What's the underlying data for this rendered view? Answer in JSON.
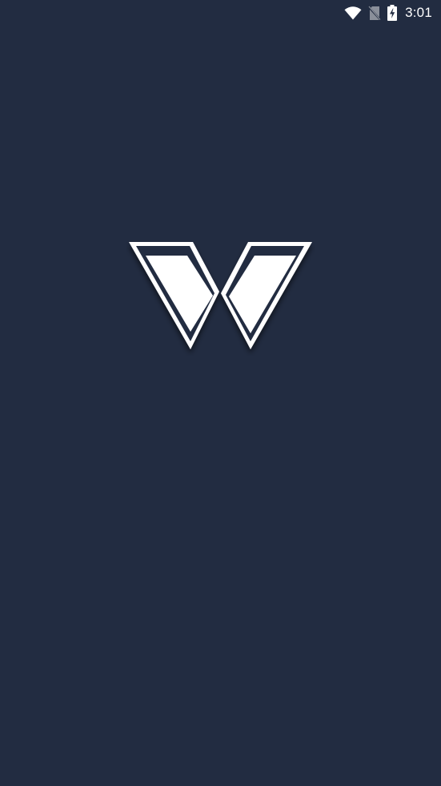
{
  "status_bar": {
    "time": "3:01",
    "icons": [
      "wifi-icon",
      "no-sim-icon",
      "battery-charging-icon"
    ],
    "icon_color": "#ffffff"
  },
  "splash": {
    "logo": "app-logo-w",
    "background_color": "#222c41",
    "logo_color": "#ffffff"
  }
}
